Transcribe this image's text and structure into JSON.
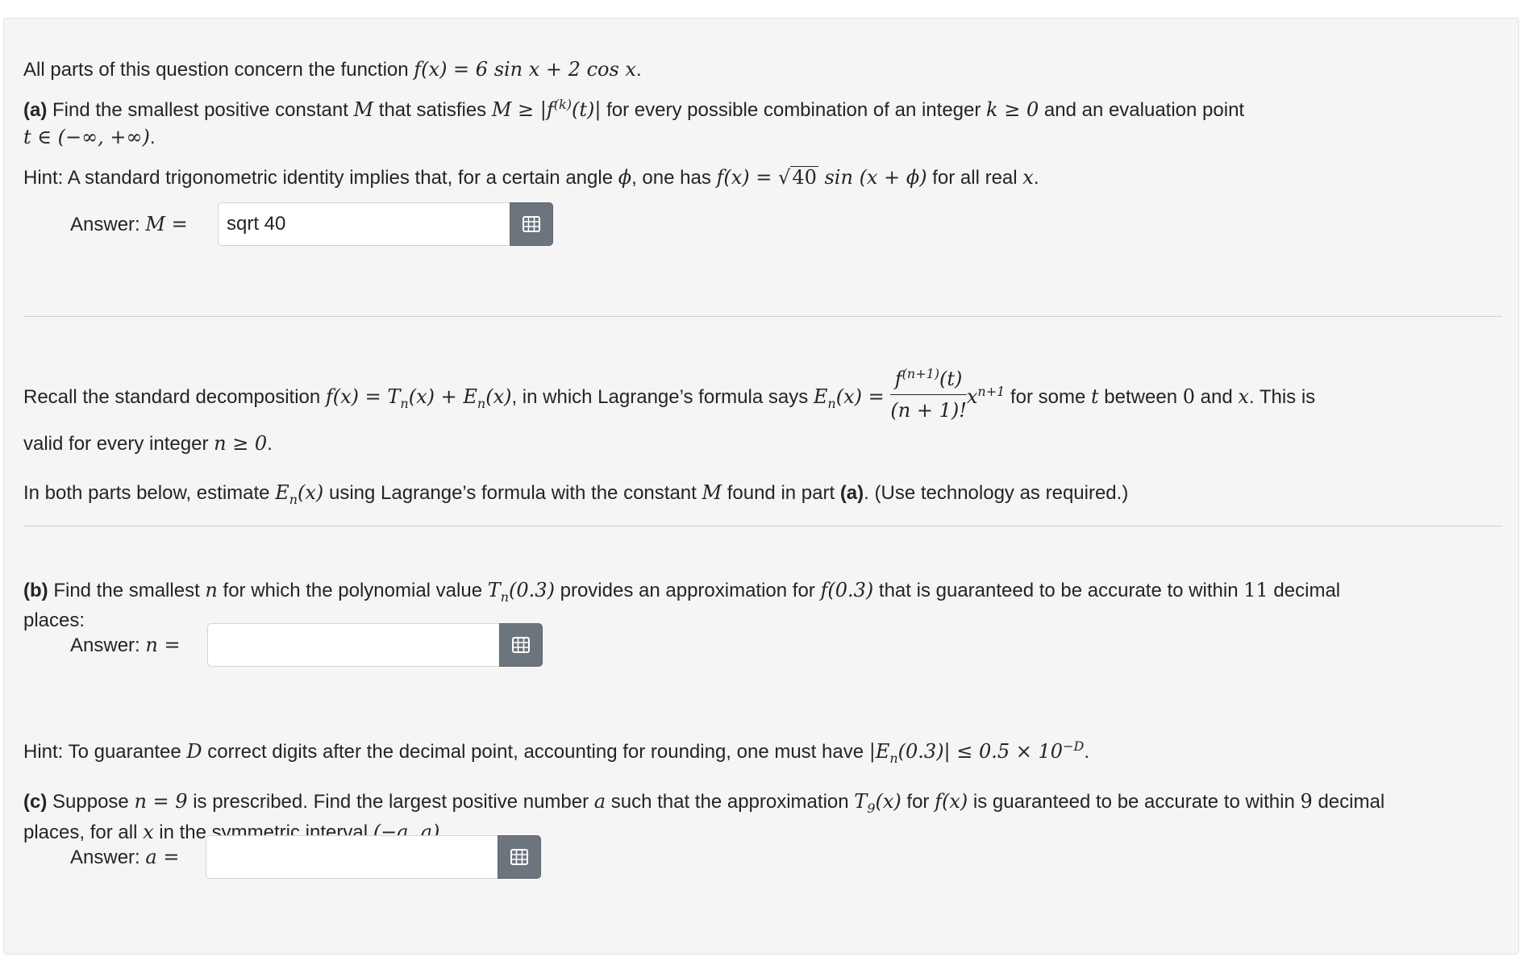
{
  "intro": {
    "text": "All parts of this question concern the function ",
    "formula": "f(x) = 6 sin x + 2 cos x",
    "end": "."
  },
  "part_a": {
    "label": "(a)",
    "text1": " Find the smallest positive constant ",
    "M": "M",
    "text2": " that satisfies ",
    "ineq": "M ≥ |f",
    "ineq_sup": "(k)",
    "ineq_end": "(t)|",
    "text3": " for every possible combination of an integer ",
    "k_cond": "k ≥ 0",
    "text4": " and an evaluation point",
    "domain": "t ∈ (−∞, +∞)",
    "end": "."
  },
  "hint_a": {
    "text1": "Hint: A standard trigonometric identity implies that, for a certain angle ",
    "phi": "ϕ",
    "text2": ", one has ",
    "f_eq": "f(x) = ",
    "sqrt_arg": "40",
    "sin_part": " sin (x + ϕ)",
    "text3": " for all real ",
    "x": "x",
    "end": "."
  },
  "answer_a": {
    "label": "Answer: ",
    "var": "M =",
    "value": "sqrt 40"
  },
  "recall": {
    "text1": "Recall the standard decomposition ",
    "decomp": "f(x) = T",
    "n1": "n",
    "decomp2": "(x) + E",
    "n2": "n",
    "decomp3": "(x)",
    "text2": ", in which Lagrange’s formula says ",
    "en": "E",
    "en_sub": "n",
    "en_rest": "(x) = ",
    "frac_num": "f",
    "frac_num_sup": "(n+1)",
    "frac_num_end": "(t)",
    "frac_den": "(n + 1)!",
    "xpow": "x",
    "xpow_sup": "n+1",
    "text3": " for some ",
    "t": "t",
    "text4": " between ",
    "zero": "0",
    "text5": " and ",
    "x": "x",
    "text6": ". This is",
    "line2_text": "valid for every integer ",
    "n_cond": "n ≥ 0",
    "line2_end": "."
  },
  "both": {
    "text1": "In both parts below, estimate ",
    "en": "E",
    "en_sub": "n",
    "en_rest": "(x)",
    "text2": " using Lagrange’s formula with the constant ",
    "M": "M",
    "text3": " found in part ",
    "part": "(a)",
    "text4": ". (Use technology as required.)"
  },
  "part_b": {
    "label": "(b)",
    "text1": " Find the smallest ",
    "n": "n",
    "text2": " for which the polynomial value ",
    "tn": "T",
    "tn_sub": "n",
    "tn_rest": "(0.3)",
    "text3": " provides an approximation for ",
    "f03": "f(0.3)",
    "text4": " that is guaranteed to be accurate to within ",
    "digits": "11",
    "text5": " decimal",
    "line2": "places:"
  },
  "answer_b": {
    "label": "Answer: ",
    "var": "n =",
    "value": ""
  },
  "hint_b": {
    "text1": "Hint: To guarantee ",
    "D": "D",
    "text2": " correct digits after the decimal point, accounting for rounding, one must have ",
    "ineq1": "|E",
    "ineq_sub": "n",
    "ineq2": "(0.3)| ≤ 0.5 × 10",
    "ineq_sup": "−D",
    "end": "."
  },
  "part_c": {
    "label": "(c)",
    "text1": " Suppose ",
    "n_eq": "n = 9",
    "text2": " is prescribed. Find the largest positive number ",
    "a": "a",
    "text3": " such that the approximation ",
    "t9": "T",
    "t9_sub": "9",
    "t9_rest": "(x)",
    "text4": " for ",
    "fx": "f(x)",
    "text5": " is guaranteed to be accurate to within ",
    "digits": "9",
    "text6": " decimal",
    "line2_text": "places, for all ",
    "x": "x",
    "line2_text2": " in the symmetric interval ",
    "interval": "(−a, a)",
    "line2_end": "."
  },
  "answer_c": {
    "label": "Answer: ",
    "var": "a =",
    "value": ""
  },
  "icons": {
    "calculator": "calculator-grid-icon"
  },
  "colors": {
    "button": "#6c757d",
    "card": "#f5f5f5"
  }
}
